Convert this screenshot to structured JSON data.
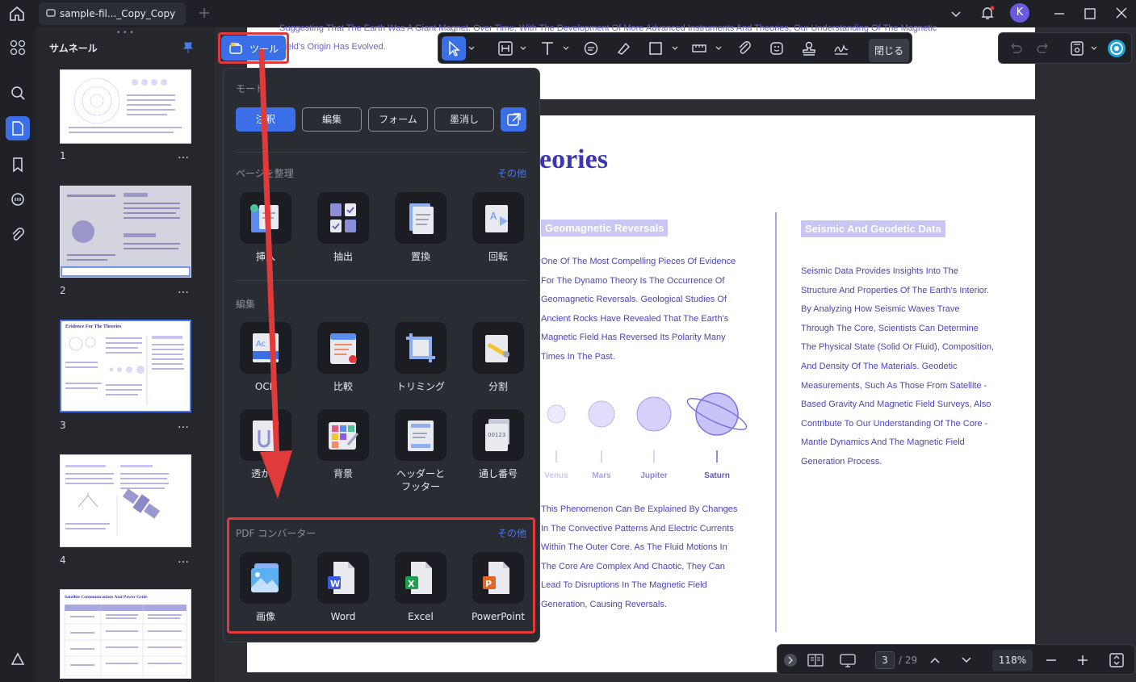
{
  "window": {
    "tab_title": "sample-fil..._Copy_Copy",
    "avatar_initial": "K"
  },
  "thumbnails": {
    "title": "サムネール",
    "pages": [
      {
        "number": "1"
      },
      {
        "number": "2"
      },
      {
        "number": "3",
        "heading": "Evidence For The Theories"
      },
      {
        "number": "4"
      },
      {
        "heading": "Satellite Communications And Power Grids"
      }
    ],
    "more": "…"
  },
  "tools_button": {
    "label": "ツール"
  },
  "tools_panel": {
    "mode": {
      "title": "モード",
      "buttons": [
        "注釈",
        "編集",
        "フォーム",
        "墨消し"
      ],
      "active": "注釈"
    },
    "organize": {
      "title": "ページを整理",
      "more": "その他",
      "items": [
        "挿入",
        "抽出",
        "置換",
        "回転"
      ]
    },
    "edit": {
      "title": "編集",
      "items": [
        "OCR",
        "比較",
        "トリミング",
        "分割",
        "透かし",
        "背景",
        "ヘッダーと\nフッター",
        "通し番号"
      ]
    },
    "convert": {
      "title": "PDF コンバーター",
      "more": "その他",
      "items": [
        "画像",
        "Word",
        "Excel",
        "PowerPoint"
      ]
    }
  },
  "annot_toolbar": {
    "close_label": "閉じる"
  },
  "document": {
    "top_text": "Suggesting That The Earth Was A Giant Magnet. Over Time, With The Development Of More Advanced Instruments And Theories, Our Understanding Of The Magnetic Field's Origin Has Evolved.",
    "heading_partial": "eories",
    "col1": {
      "heading": "Geomagnetic Reversals",
      "lines": [
        "One Of The Most Compelling Pieces Of Evidence",
        "For The Dynamo Theory Is The Occurrence Of",
        "Geomagnetic Reversals. Geological Studies Of",
        "Ancient Rocks Have Revealed That The Earth's",
        "Magnetic Field Has Reversed Its Polarity Many",
        "Times In The Past."
      ],
      "planets": [
        "Venus",
        "Mars",
        "Jupiter",
        "Saturn"
      ],
      "lines2": [
        "This Phenomenon Can Be Explained By Changes",
        "In The Convective Patterns And Electric Currents",
        "Within The Outer Core. As The Fluid Motions In",
        "The Core Are Complex And Chaotic, They Can",
        "Lead To Disruptions In The Magnetic Field",
        "Generation, Causing Reversals."
      ]
    },
    "col2": {
      "heading": "Seismic And Geodetic Data",
      "lines": [
        "Seismic Data Provides Insights Into The",
        "Structure And Properties Of The Earth's Interior.",
        "By Analyzing How Seismic Waves Trave",
        "Through The Core, Scientists Can Determine",
        "The Physical State (Solid Or Fluid), Composition,",
        "And Density Of The Materials. Geodetic",
        "Measurements, Such As Those From Satellite -",
        "Based Gravity And Magnetic Field Surveys, Also",
        "Contribute To Our Understanding Of The Core -",
        "Mantle Dynamics And The Magnetic Field",
        "Generation Process."
      ]
    }
  },
  "nav": {
    "current_page": "3",
    "total_pages": "/ 29",
    "zoom": "118%"
  },
  "colors": {
    "accent": "#3b6fe8",
    "highlight": "#e03a3a",
    "doc_text": "#4b45b8"
  }
}
